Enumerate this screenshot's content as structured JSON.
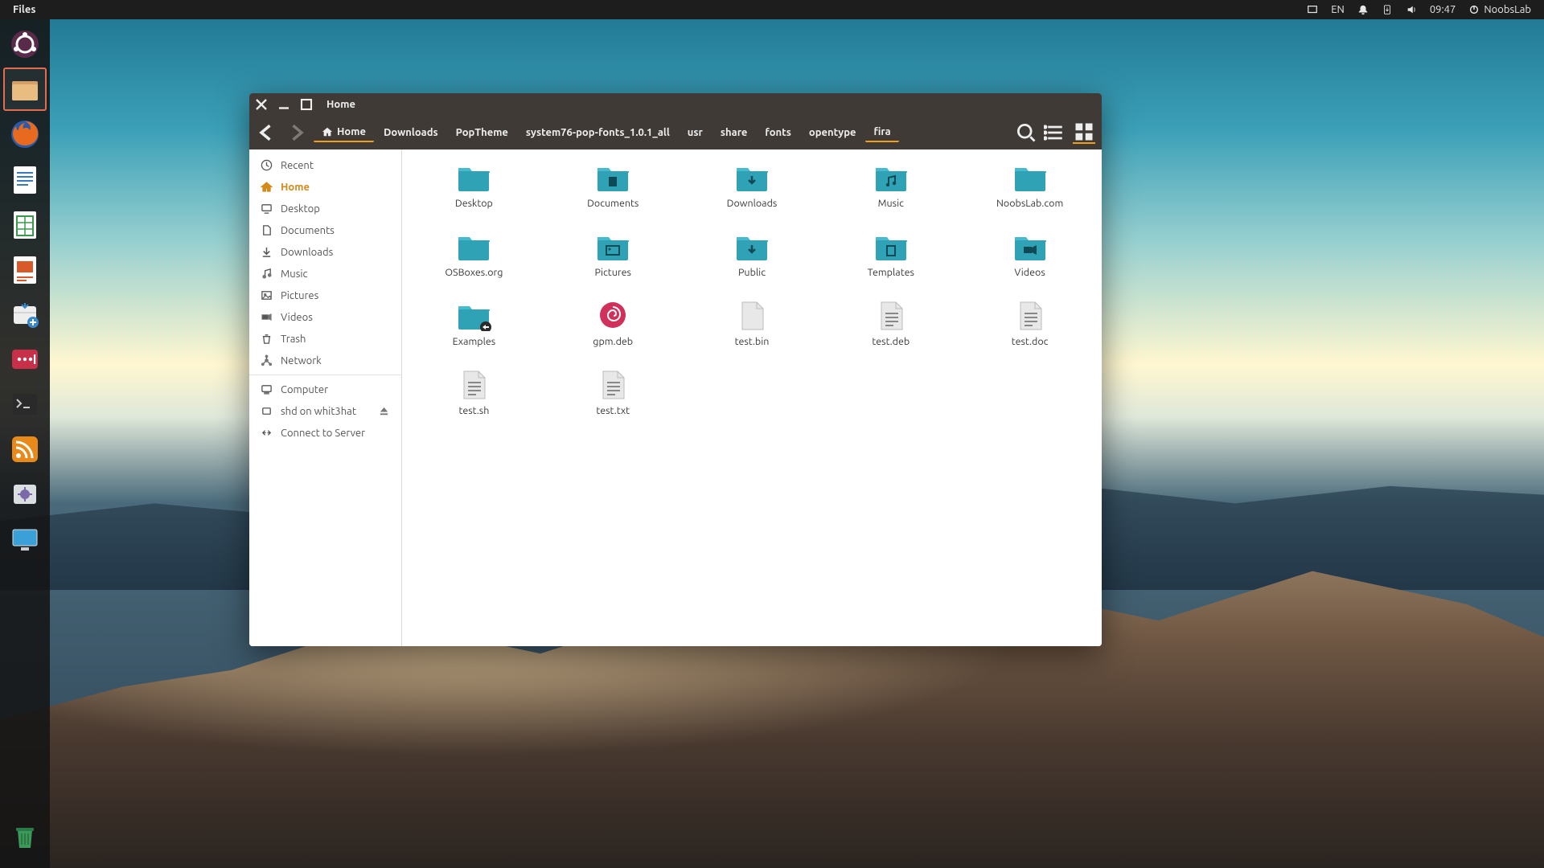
{
  "top_panel": {
    "app_label": "Files",
    "lang": "EN",
    "time": "09:47",
    "user": "NoobsLab"
  },
  "dock": {
    "items": [
      {
        "name": "ubuntu-dash",
        "active": false
      },
      {
        "name": "files",
        "active": true
      },
      {
        "name": "firefox",
        "active": false
      },
      {
        "name": "writer",
        "active": false
      },
      {
        "name": "calc",
        "active": false
      },
      {
        "name": "impress",
        "active": false
      },
      {
        "name": "software",
        "active": false
      },
      {
        "name": "lastpass",
        "active": false
      },
      {
        "name": "terminal",
        "active": false
      },
      {
        "name": "rss",
        "active": false
      },
      {
        "name": "settings",
        "active": false
      },
      {
        "name": "display",
        "active": false
      }
    ],
    "trash": "trash"
  },
  "window": {
    "title": "Home",
    "crumbs": [
      {
        "label": "Home",
        "icon": "home",
        "active": true
      },
      {
        "label": "Downloads"
      },
      {
        "label": "PopTheme"
      },
      {
        "label": "system76-pop-fonts_1.0.1_all"
      },
      {
        "label": "usr"
      },
      {
        "label": "share"
      },
      {
        "label": "fonts"
      },
      {
        "label": "opentype"
      },
      {
        "label": "fira",
        "last": true
      }
    ]
  },
  "sidebar": {
    "groups": [
      [
        {
          "label": "Recent",
          "icon": "clock"
        },
        {
          "label": "Home",
          "icon": "home",
          "selected": true
        },
        {
          "label": "Desktop",
          "icon": "desktop"
        },
        {
          "label": "Documents",
          "icon": "document"
        },
        {
          "label": "Downloads",
          "icon": "download"
        },
        {
          "label": "Music",
          "icon": "music"
        },
        {
          "label": "Pictures",
          "icon": "picture"
        },
        {
          "label": "Videos",
          "icon": "video"
        },
        {
          "label": "Trash",
          "icon": "trash"
        },
        {
          "label": "Network",
          "icon": "network"
        }
      ],
      [
        {
          "label": "Computer",
          "icon": "computer"
        },
        {
          "label": "shd on whit3hat",
          "icon": "mount",
          "eject": true
        },
        {
          "label": "Connect to Server",
          "icon": "connect"
        }
      ]
    ]
  },
  "files": [
    {
      "label": "Desktop",
      "type": "folder",
      "glyph": "blank"
    },
    {
      "label": "Documents",
      "type": "folder",
      "glyph": "doc"
    },
    {
      "label": "Downloads",
      "type": "folder",
      "glyph": "down"
    },
    {
      "label": "Music",
      "type": "folder",
      "glyph": "music"
    },
    {
      "label": "NoobsLab.com",
      "type": "folder",
      "glyph": "blank"
    },
    {
      "label": "OSBoxes.org",
      "type": "folder",
      "glyph": "blank"
    },
    {
      "label": "Pictures",
      "type": "folder",
      "glyph": "pic"
    },
    {
      "label": "Public",
      "type": "folder",
      "glyph": "down"
    },
    {
      "label": "Templates",
      "type": "folder",
      "glyph": "temp"
    },
    {
      "label": "Videos",
      "type": "folder",
      "glyph": "vid"
    },
    {
      "label": "Examples",
      "type": "folder-link",
      "glyph": "blank"
    },
    {
      "label": "gpm.deb",
      "type": "debian"
    },
    {
      "label": "test.bin",
      "type": "file"
    },
    {
      "label": "test.deb",
      "type": "textfile"
    },
    {
      "label": "test.doc",
      "type": "textfile"
    },
    {
      "label": "test.sh",
      "type": "textfile"
    },
    {
      "label": "test.txt",
      "type": "textfile"
    }
  ],
  "colors": {
    "folder": "#2fa3b5",
    "accent": "#f0a020",
    "accent2": "#d58a1a",
    "debian": "#d0305a"
  }
}
